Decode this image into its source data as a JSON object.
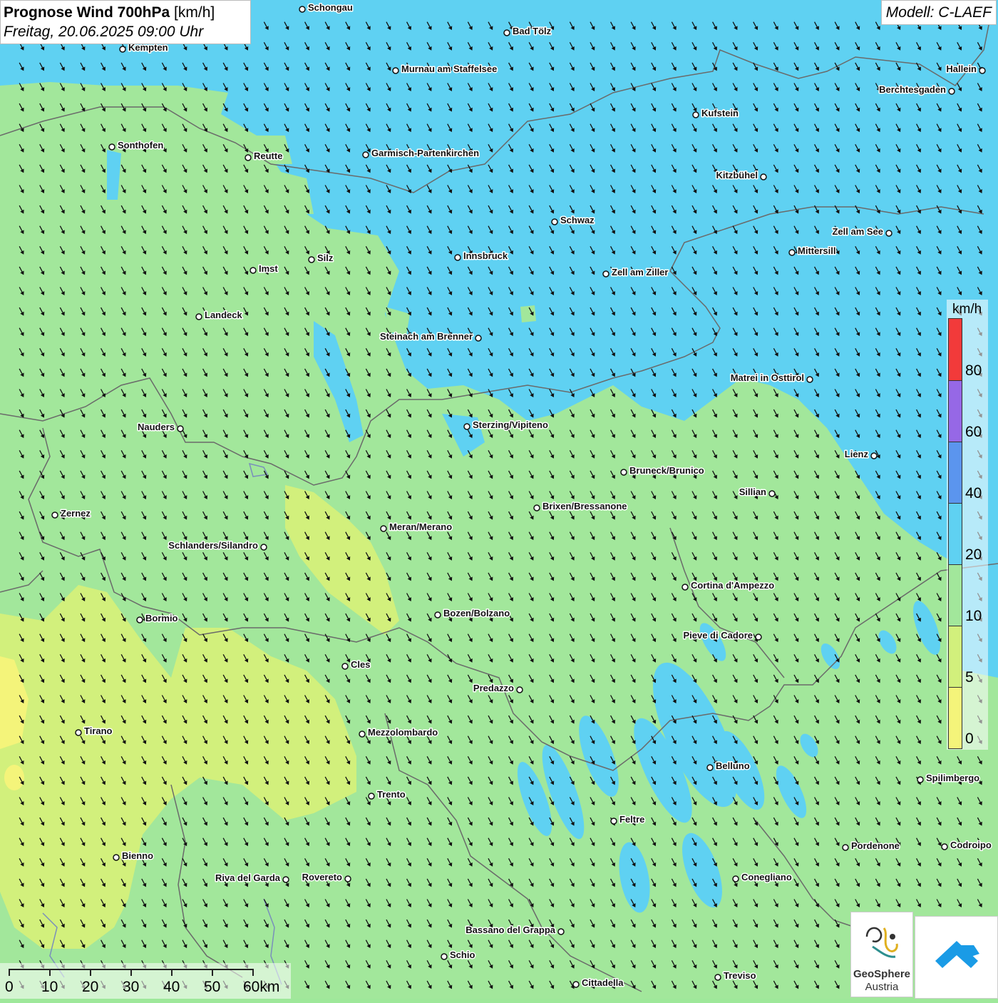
{
  "header": {
    "title_bold": "Prognose Wind 700hPa",
    "title_unit": " [km/h]",
    "subtitle": "Freitag, 20.06.2025 09:00 Uhr",
    "model": "Modell: C-LAEF"
  },
  "colors": {
    "wind_0_5": "#f4f47a",
    "wind_5_10": "#d2f07c",
    "wind_10_20": "#a2e79b",
    "wind_20_40": "#5fd1f2",
    "wind_40_60": "#5b95ee",
    "wind_60_80": "#9668e6",
    "wind_80_plus": "#f23a3a",
    "arrow": "#111111"
  },
  "wind": {
    "arrow_direction": "north-west",
    "arrow_icon": "arrow-icon"
  },
  "legend": {
    "unit": "km/h",
    "ticks": [
      "80",
      "60",
      "40",
      "20",
      "10",
      "5",
      "0"
    ]
  },
  "scale_bar": {
    "labels": [
      "0",
      "10",
      "20",
      "30",
      "40",
      "50",
      "60km"
    ]
  },
  "cities": [
    {
      "name": "Schongau"
    },
    {
      "name": "Bad Tölz"
    },
    {
      "name": "Kempten"
    },
    {
      "name": "Murnau am Staffelsee"
    },
    {
      "name": "Hallein"
    },
    {
      "name": "Berchtesgaden"
    },
    {
      "name": "Kufstein"
    },
    {
      "name": "Sonthofen"
    },
    {
      "name": "Reutte"
    },
    {
      "name": "Garmisch-Partenkirchen"
    },
    {
      "name": "Kitzbühel"
    },
    {
      "name": "Schwaz"
    },
    {
      "name": "Zell am See"
    },
    {
      "name": "Mittersill"
    },
    {
      "name": "Innsbruck"
    },
    {
      "name": "Silz"
    },
    {
      "name": "Imst"
    },
    {
      "name": "Zell am Ziller"
    },
    {
      "name": "Landeck"
    },
    {
      "name": "Steinach am Brenner"
    },
    {
      "name": "Matrei in Osttirol"
    },
    {
      "name": "Nauders"
    },
    {
      "name": "Sterzing/Vipiteno"
    },
    {
      "name": "Lienz"
    },
    {
      "name": "Bruneck/Brunico"
    },
    {
      "name": "Sillian"
    },
    {
      "name": "Brixen/Bressanone"
    },
    {
      "name": "Zernez"
    },
    {
      "name": "Meran/Merano"
    },
    {
      "name": "Schlanders/Silandro"
    },
    {
      "name": "Cortina d'Ampezzo"
    },
    {
      "name": "Bozen/Bolzano"
    },
    {
      "name": "Bormio"
    },
    {
      "name": "Pieve di Cadore"
    },
    {
      "name": "Cles"
    },
    {
      "name": "Predazzo"
    },
    {
      "name": "Tirano"
    },
    {
      "name": "Mezzolombardo"
    },
    {
      "name": "Belluno"
    },
    {
      "name": "Spilimbergo"
    },
    {
      "name": "Trento"
    },
    {
      "name": "Feltre"
    },
    {
      "name": "Bienno"
    },
    {
      "name": "Pordenone"
    },
    {
      "name": "Codroipo"
    },
    {
      "name": "Riva del Garda"
    },
    {
      "name": "Rovereto"
    },
    {
      "name": "Conegliano"
    },
    {
      "name": "Bassano del Grappa"
    },
    {
      "name": "Schio"
    },
    {
      "name": "Treviso"
    },
    {
      "name": "Cittadella"
    }
  ],
  "logos": {
    "geosphere_line1": "GeoSphere",
    "geosphere_line2": "Austria"
  }
}
